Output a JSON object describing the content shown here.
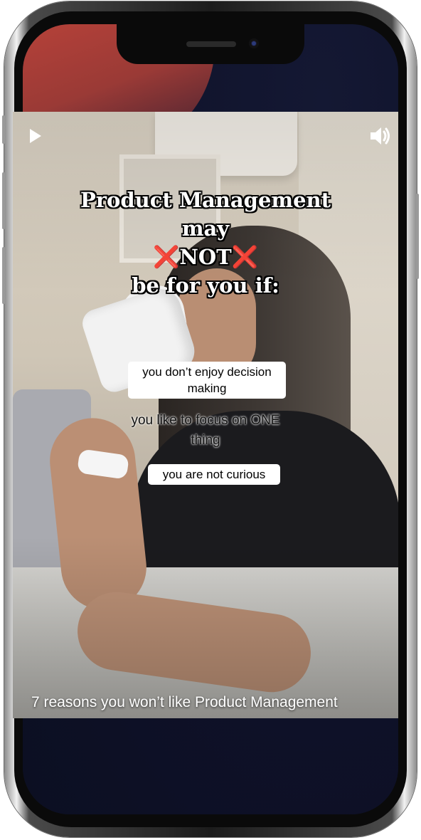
{
  "video": {
    "overlay_title_lines": [
      "Product Management",
      "may",
      "NOT",
      "be for you if:"
    ],
    "x_mark_glyph": "❌",
    "reasons": [
      {
        "lines": [
          "you don’t enjoy decision",
          "making"
        ],
        "style": "sticker"
      },
      {
        "lines": [
          "you like to focus on ONE",
          "thing"
        ],
        "style": "plain"
      },
      {
        "lines": [
          "you are not curious"
        ],
        "style": "sticker"
      }
    ],
    "caption": "7 reasons you won’t like Product Management"
  },
  "controls": {
    "play_icon": "play-icon",
    "sound_icon": "speaker-volume-icon"
  },
  "colors": {
    "x_mark": "#e53935",
    "screen_background": "#0f1226",
    "accent_blob": "#c0443a"
  }
}
